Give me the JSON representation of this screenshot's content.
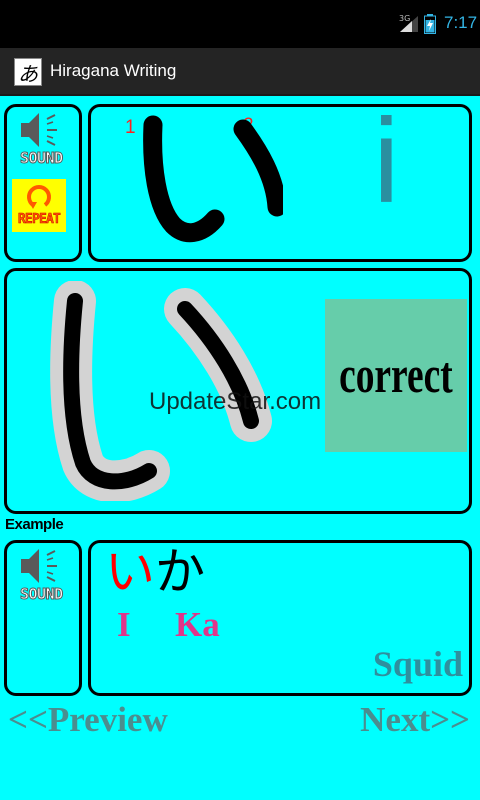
{
  "status_bar": {
    "network": "3G",
    "time": "7:17"
  },
  "app": {
    "title": "Hiragana Writing",
    "icon_glyph": "あ"
  },
  "lesson": {
    "sound_label": "SOUND",
    "repeat_label": "REPEAT",
    "stroke_numbers": [
      "1",
      "2"
    ],
    "kana": "い",
    "romaji": "i"
  },
  "practice": {
    "result": "correct",
    "watermark": "UpdateStar.com"
  },
  "example": {
    "heading": "Example",
    "sound_label": "SOUND",
    "kana_highlight": "い",
    "kana_rest": "か",
    "romaji": [
      "I",
      "Ka"
    ],
    "meaning": "Squid"
  },
  "nav": {
    "prev": "<<Preview",
    "next": "Next>>"
  },
  "colors": {
    "background": "#00ffff",
    "correct_box": "#66cdaa",
    "repeat_button": "#ffff00",
    "romaji_pink": "#e0358a",
    "highlight_red": "#ff0000"
  }
}
